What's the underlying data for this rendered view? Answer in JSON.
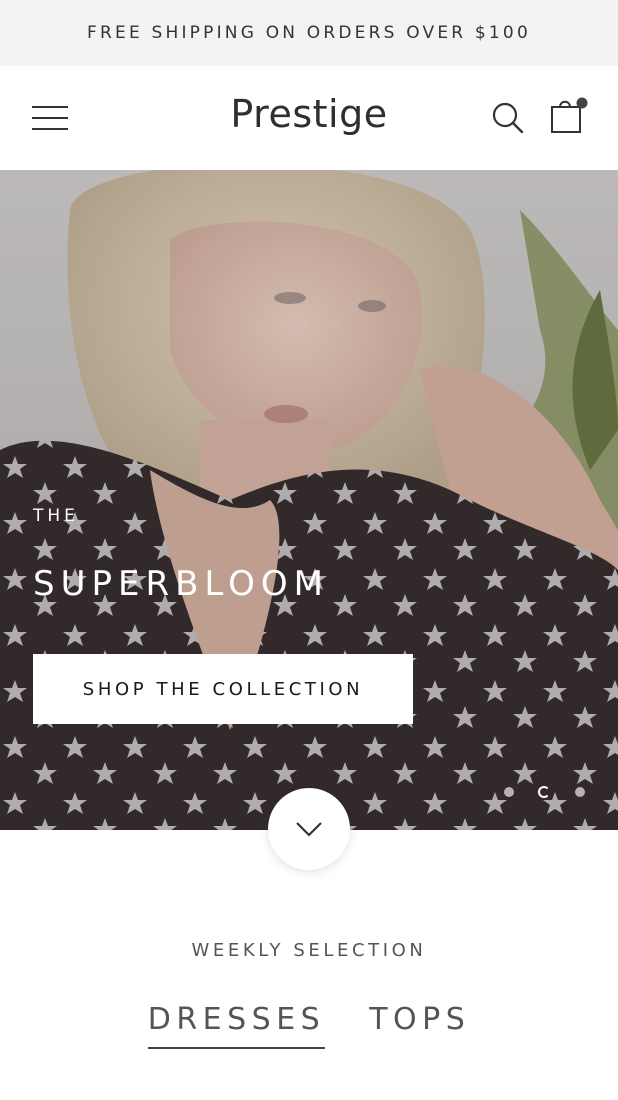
{
  "announcement": {
    "text": "FREE SHIPPING ON ORDERS OVER $100"
  },
  "header": {
    "logo": "Prestige",
    "menu_icon": "hamburger-menu-icon",
    "search_icon": "search-icon",
    "cart_icon": "shopping-bag-icon"
  },
  "hero": {
    "kicker": "THE",
    "title": "SUPERBLOOM",
    "cta_label": "SHOP THE COLLECTION",
    "slides_count": 3,
    "active_slide": 2
  },
  "scroll_icon": "chevron-down-icon",
  "weekly": {
    "label": "WEEKLY SELECTION",
    "tabs": [
      {
        "label": "DRESSES",
        "active": true
      },
      {
        "label": "TOPS",
        "active": false
      }
    ]
  },
  "colors": {
    "announcement_bg": "#f3f3f3",
    "text": "#2b2b2b",
    "accent": "#444444"
  }
}
